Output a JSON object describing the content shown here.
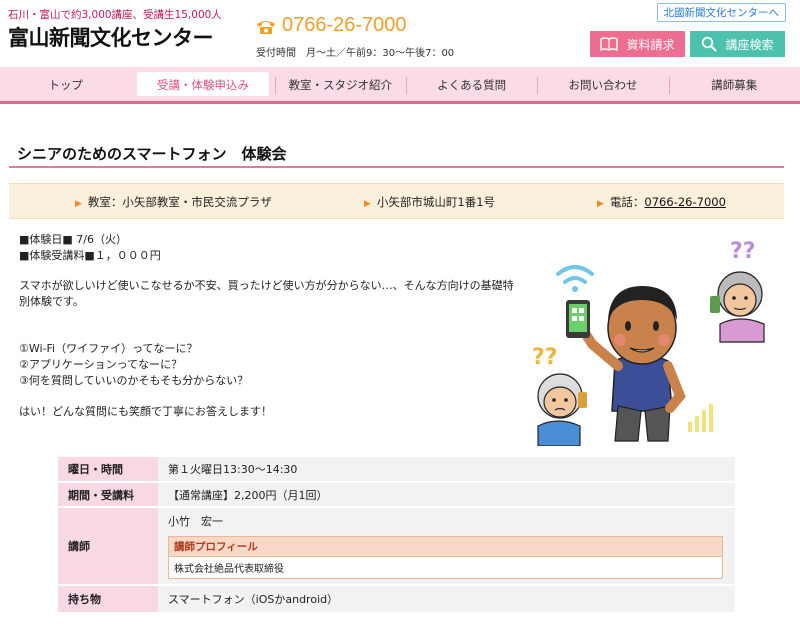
{
  "header": {
    "tagline": "石川・富山で約3,000講座、受講生15,000人",
    "logo": "富山新聞文化センター",
    "phone": "0766-26-7000",
    "hours": "受付時間　月～土／午前9：30～午後7：00",
    "hokkoku_link": "北國新聞文化センターへ",
    "doc_button": "資料請求",
    "search_button": "講座検索",
    "colors": {
      "pink": "#ee6e91",
      "teal": "#4cc1ad",
      "orange": "#f0a028"
    }
  },
  "nav": {
    "items": [
      {
        "label": "トップ"
      },
      {
        "label": "受講・体験申込み"
      },
      {
        "label": "教室・スタジオ紹介"
      },
      {
        "label": "よくある質問"
      },
      {
        "label": "お問い合わせ"
      },
      {
        "label": "講師募集"
      }
    ],
    "active": "受講・体験申込み"
  },
  "course": {
    "title": "シニアのためのスマートフォン　体験会",
    "classroom": "教室：小矢部教室・市民交流プラザ",
    "address": "小矢部市城山町1番1号",
    "tel_label": "電話：",
    "tel": "0766-26-7000",
    "trial_date": "■体験日■ 7/6（火）",
    "trial_fee": "■体験受講料■１，０００円",
    "desc_line1": "スマホが欲しいけど使いこなせるか不安、買ったけど使い方が分からない…、そんな方向けの基礎特",
    "desc_line2": "別体験です。",
    "q1": "①Wi-Fi（ワイファイ）ってなーに？",
    "q2": "②アプリケーションってなーに？",
    "q3": "③何を質問していいのかそもそも分からない？",
    "closing": "はい！どんな質問にも笑顔で丁寧にお答えします！"
  },
  "details": {
    "schedule_label": "曜日・時間",
    "schedule_value": "第１火曜日13:30～14:30",
    "fee_label": "期間・受講料",
    "fee_value": "【通常講座】2,200円（月1回）",
    "instructor_label": "講師",
    "instructor_name": "小竹　宏一",
    "profile_heading": "講師プロフィール",
    "profile_text": "株式会社絶品代表取締役",
    "items_label": "持ち物",
    "items_value": "スマートフォン（iOSかandroid）"
  }
}
